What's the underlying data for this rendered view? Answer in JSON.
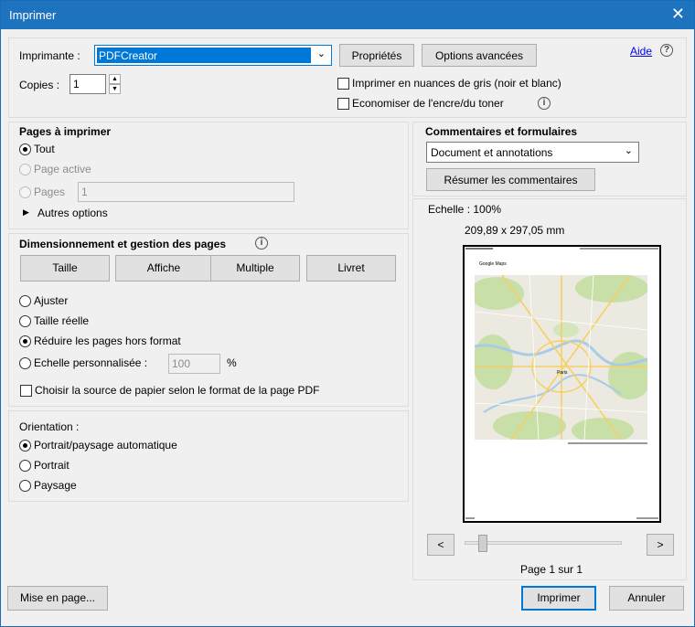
{
  "window": {
    "title": "Imprimer",
    "close_glyph": "✕"
  },
  "printer": {
    "label": "Imprimante :",
    "selected": "PDFCreator",
    "properties_button": "Propriétés",
    "advanced_button": "Options avancées",
    "help_link": "Aide",
    "help_glyph": "?",
    "copies_label": "Copies :",
    "copies_value": "1",
    "grayscale_label": "Imprimer en nuances de gris (noir et blanc)",
    "grayscale_checked": false,
    "save_ink_label": "Economiser de l'encre/du toner",
    "save_ink_checked": false
  },
  "pages": {
    "title": "Pages à imprimer",
    "all_label": "Tout",
    "current_label": "Page active",
    "range_label": "Pages",
    "range_value": "1",
    "more_options": "Autres options",
    "selected": "all"
  },
  "sizing": {
    "title": "Dimensionnement et gestion des pages",
    "buttons": [
      "Taille",
      "Affiche",
      "Multiple",
      "Livret"
    ],
    "fit_label": "Ajuster",
    "actual_label": "Taille réelle",
    "shrink_label": "Réduire les pages hors format",
    "custom_label": "Echelle personnalisée :",
    "custom_value": "100",
    "percent": "%",
    "paper_source_label": "Choisir la source de papier selon le format de la page PDF",
    "selected": "shrink"
  },
  "orientation": {
    "title": "Orientation :",
    "auto_label": "Portrait/paysage automatique",
    "portrait_label": "Portrait",
    "landscape_label": "Paysage",
    "selected": "auto"
  },
  "comments": {
    "title": "Commentaires et formulaires",
    "selected": "Document et annotations",
    "summarize_button": "Résumer les commentaires"
  },
  "preview": {
    "scale": "Echelle : 100%",
    "dimensions": "209,89 x 297,05 mm",
    "prev": "<",
    "next": ">",
    "page_info": "Page 1 sur 1",
    "map_heading": "Google Maps",
    "map_label": "Paris"
  },
  "footer": {
    "page_setup": "Mise en page...",
    "print": "Imprimer",
    "cancel": "Annuler"
  },
  "colors": {
    "titlebar": "#1e73be",
    "accent": "#0078d7",
    "map_green": "#c8dfa8",
    "map_water": "#a8cbe8"
  }
}
